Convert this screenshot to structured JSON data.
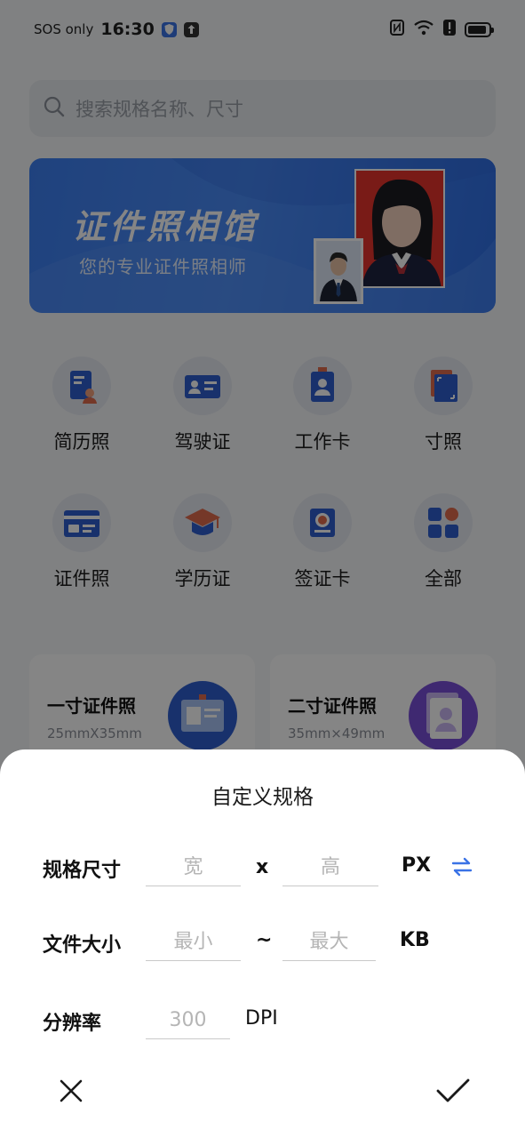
{
  "status_bar": {
    "carrier": "SOS only",
    "time": "16:30"
  },
  "search": {
    "placeholder": "搜索规格名称、尺寸"
  },
  "banner": {
    "title": "证件照相馆",
    "subtitle": "您的专业证件照相师"
  },
  "categories": [
    {
      "label": "简历照",
      "icon": "resume-icon"
    },
    {
      "label": "驾驶证",
      "icon": "driver-license-icon"
    },
    {
      "label": "工作卡",
      "icon": "work-badge-icon"
    },
    {
      "label": "寸照",
      "icon": "inch-photo-icon"
    },
    {
      "label": "证件照",
      "icon": "id-card-icon"
    },
    {
      "label": "学历证",
      "icon": "graduation-cap-icon"
    },
    {
      "label": "签证卡",
      "icon": "visa-icon"
    },
    {
      "label": "全部",
      "icon": "grid-icon"
    }
  ],
  "cards": [
    {
      "title": "一寸证件照",
      "size": "25mmX35mm"
    },
    {
      "title": "二寸证件照",
      "size": "35mm×49mm"
    }
  ],
  "sheet": {
    "title": "自定义规格",
    "size_label": "规格尺寸",
    "width_placeholder": "宽",
    "times": "x",
    "height_placeholder": "高",
    "size_unit": "PX",
    "file_label": "文件大小",
    "min_placeholder": "最小",
    "tilde": "~",
    "max_placeholder": "最大",
    "file_unit": "KB",
    "dpi_label": "分辨率",
    "dpi_placeholder": "300",
    "dpi_unit": "DPI"
  },
  "colors": {
    "accent": "#3b73e6",
    "banner": "#4a8cf8"
  }
}
